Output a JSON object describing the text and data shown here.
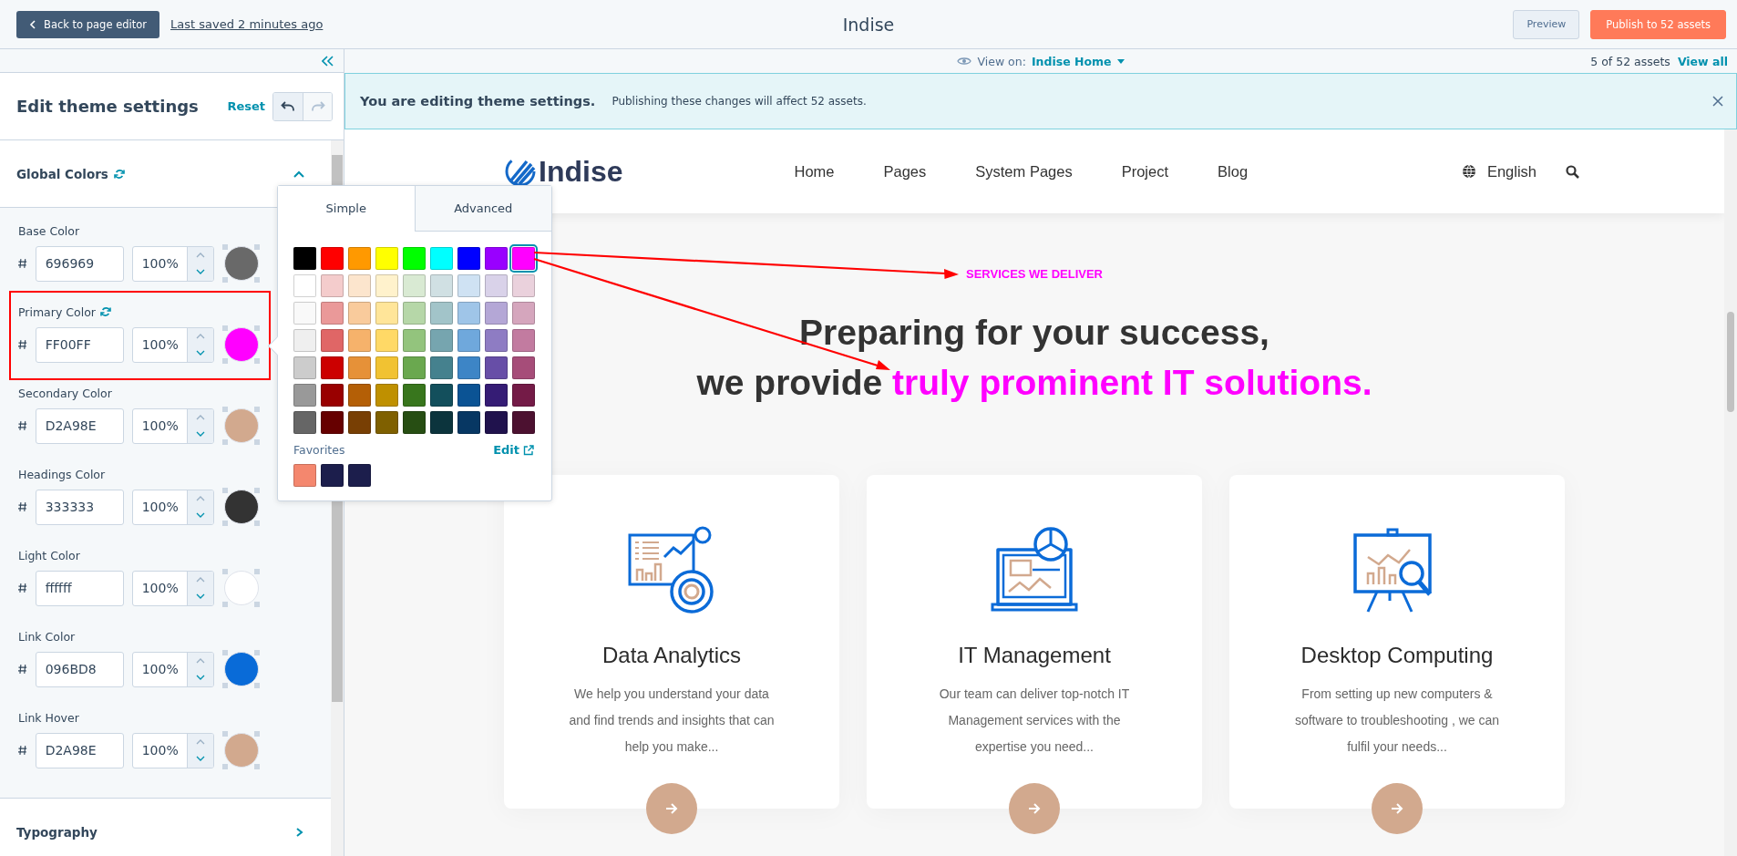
{
  "top_bar": {
    "back_button": "Back to page editor",
    "last_saved": "Last saved 2 minutes ago",
    "title": "Indise",
    "preview_button": "Preview",
    "publish_button": "Publish to 52 assets"
  },
  "sidebar": {
    "title": "Edit theme settings",
    "reset": "Reset",
    "undo_disabled": false,
    "redo_disabled": true,
    "sections": [
      {
        "title": "Global Colors",
        "expanded": true,
        "synced": true,
        "colors": [
          {
            "label": "Base Color",
            "hex": "696969",
            "opacity": "100%",
            "color": "#696969",
            "synced": false,
            "highlighted": false
          },
          {
            "label": "Primary Color",
            "hex": "FF00FF",
            "opacity": "100%",
            "color": "#ff00ff",
            "synced": true,
            "highlighted": true
          },
          {
            "label": "Secondary Color",
            "hex": "D2A98E",
            "opacity": "100%",
            "color": "#d2a98e",
            "synced": false,
            "highlighted": false
          },
          {
            "label": "Headings Color",
            "hex": "333333",
            "opacity": "100%",
            "color": "#333333",
            "synced": false,
            "highlighted": false
          },
          {
            "label": "Light Color",
            "hex": "ffffff",
            "opacity": "100%",
            "color": "#ffffff",
            "synced": false,
            "highlighted": false
          },
          {
            "label": "Link Color",
            "hex": "096BD8",
            "opacity": "100%",
            "color": "#096bd8",
            "synced": false,
            "highlighted": false
          },
          {
            "label": "Link Hover",
            "hex": "D2A98E",
            "opacity": "100%",
            "color": "#d2a98e",
            "synced": false,
            "highlighted": false
          }
        ]
      },
      {
        "title": "Typography",
        "expanded": false,
        "synced": false
      }
    ]
  },
  "view_bar": {
    "label": "View on:",
    "page": "Indise Home",
    "count": "5 of 52 assets",
    "view_all": "View all"
  },
  "banner": {
    "title": "You are editing theme settings.",
    "message": "Publishing these changes will affect 52 assets."
  },
  "color_picker": {
    "tabs": [
      {
        "label": "Simple",
        "selected": true
      },
      {
        "label": "Advanced",
        "selected": false
      }
    ],
    "swatch_rows": [
      [
        {
          "color": "#000000",
          "selected": false
        },
        {
          "color": "#ff0000",
          "selected": false
        },
        {
          "color": "#ff9900",
          "selected": false
        },
        {
          "color": "#ffff00",
          "selected": false
        },
        {
          "color": "#00ff00",
          "selected": false
        },
        {
          "color": "#00ffff",
          "selected": false
        },
        {
          "color": "#0000ff",
          "selected": false
        },
        {
          "color": "#9900ff",
          "selected": false
        },
        {
          "color": "#ff00ff",
          "selected": true
        }
      ],
      [
        {
          "color": "#ffffff",
          "selected": false
        },
        {
          "color": "#f4cccc",
          "selected": false
        },
        {
          "color": "#fce5cd",
          "selected": false
        },
        {
          "color": "#fff2cc",
          "selected": false
        },
        {
          "color": "#d9ead3",
          "selected": false
        },
        {
          "color": "#d0e0e3",
          "selected": false
        },
        {
          "color": "#cfe2f3",
          "selected": false
        },
        {
          "color": "#d9d2e9",
          "selected": false
        },
        {
          "color": "#ead1dc",
          "selected": false
        }
      ],
      [
        {
          "color": "#f9f9f9",
          "selected": false
        },
        {
          "color": "#ea9999",
          "selected": false
        },
        {
          "color": "#f9cb9c",
          "selected": false
        },
        {
          "color": "#ffe599",
          "selected": false
        },
        {
          "color": "#b6d7a8",
          "selected": false
        },
        {
          "color": "#a2c4c9",
          "selected": false
        },
        {
          "color": "#9fc5e8",
          "selected": false
        },
        {
          "color": "#b4a7d6",
          "selected": false
        },
        {
          "color": "#d5a6bd",
          "selected": false
        }
      ],
      [
        {
          "color": "#efefef",
          "selected": false
        },
        {
          "color": "#e06666",
          "selected": false
        },
        {
          "color": "#f6b26b",
          "selected": false
        },
        {
          "color": "#ffd966",
          "selected": false
        },
        {
          "color": "#93c47d",
          "selected": false
        },
        {
          "color": "#76a5af",
          "selected": false
        },
        {
          "color": "#6fa8dc",
          "selected": false
        },
        {
          "color": "#8e7cc3",
          "selected": false
        },
        {
          "color": "#c27ba0",
          "selected": false
        }
      ],
      [
        {
          "color": "#cccccc",
          "selected": false
        },
        {
          "color": "#cc0000",
          "selected": false
        },
        {
          "color": "#e69138",
          "selected": false
        },
        {
          "color": "#f1c232",
          "selected": false
        },
        {
          "color": "#6aa84f",
          "selected": false
        },
        {
          "color": "#45818e",
          "selected": false
        },
        {
          "color": "#3d85c6",
          "selected": false
        },
        {
          "color": "#674ea7",
          "selected": false
        },
        {
          "color": "#a64d79",
          "selected": false
        }
      ],
      [
        {
          "color": "#999999",
          "selected": false
        },
        {
          "color": "#990000",
          "selected": false
        },
        {
          "color": "#b45f06",
          "selected": false
        },
        {
          "color": "#bf9000",
          "selected": false
        },
        {
          "color": "#38761d",
          "selected": false
        },
        {
          "color": "#134f5c",
          "selected": false
        },
        {
          "color": "#0b5394",
          "selected": false
        },
        {
          "color": "#351c75",
          "selected": false
        },
        {
          "color": "#741b47",
          "selected": false
        }
      ],
      [
        {
          "color": "#666666",
          "selected": false
        },
        {
          "color": "#660000",
          "selected": false
        },
        {
          "color": "#783f04",
          "selected": false
        },
        {
          "color": "#7f6000",
          "selected": false
        },
        {
          "color": "#274e13",
          "selected": false
        },
        {
          "color": "#0c343d",
          "selected": false
        },
        {
          "color": "#073763",
          "selected": false
        },
        {
          "color": "#20124d",
          "selected": false
        },
        {
          "color": "#4c1130",
          "selected": false
        }
      ]
    ],
    "favorites_label": "Favorites",
    "edit_link": "Edit",
    "favorites": [
      {
        "color": "#f4876e"
      },
      {
        "color": "#1c1e4c"
      },
      {
        "color": "#1c1e4c"
      }
    ]
  },
  "site": {
    "logo": "Indise",
    "nav": [
      "Home",
      "Pages",
      "System Pages",
      "Project",
      "Blog"
    ],
    "language": "English",
    "eyebrow": "SERVICES WE DELIVER",
    "heading_line1": "Preparing for your success,",
    "heading_line2": "we provide",
    "heading_highlight": "truly prominent IT solutions.",
    "cards": [
      {
        "kind": "analytics",
        "title": "Data Analytics",
        "text": "We help you understand your data and find trends and insights that can help you make..."
      },
      {
        "kind": "laptop",
        "title": "IT Management",
        "text": "Our team can deliver top-notch IT Management services with the expertise you need..."
      },
      {
        "kind": "easel",
        "title": "Desktop Computing",
        "text": "From setting up new computers & software to troubleshooting , we can fulfil your needs..."
      }
    ]
  }
}
